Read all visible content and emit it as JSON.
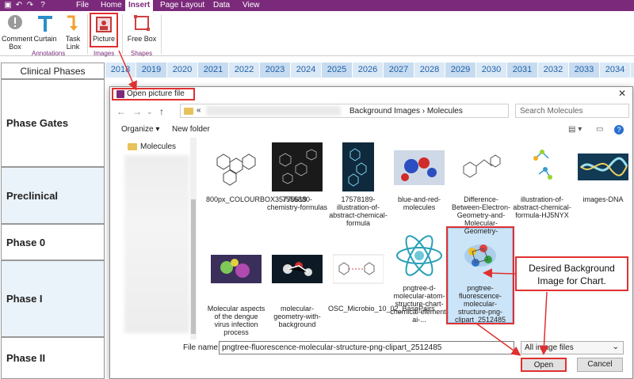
{
  "menubar": {
    "items": [
      {
        "label": "File"
      },
      {
        "label": "Home"
      },
      {
        "label": "Insert",
        "active": true
      },
      {
        "label": "Page Layout"
      },
      {
        "label": "Data"
      },
      {
        "label": "View"
      }
    ]
  },
  "ribbon": {
    "buttons": [
      {
        "label": "Comment Box",
        "line1": "Comment",
        "line2": "Box"
      },
      {
        "label": "Curtain"
      },
      {
        "label": "Task Link"
      },
      {
        "label": "Picture"
      },
      {
        "label": "Free Box"
      }
    ],
    "groups": [
      "Annotations",
      "Images",
      "Shapes"
    ]
  },
  "sheet": {
    "header": "Clinical Phases",
    "years": [
      "2018",
      "2019",
      "2020",
      "2021",
      "2022",
      "2023",
      "2024",
      "2025",
      "2026",
      "2027",
      "2028",
      "2029",
      "2030",
      "2031",
      "2032",
      "2033",
      "2034"
    ],
    "rows": [
      "Phase Gates",
      "Preclinical",
      "Phase 0",
      "Phase I",
      "Phase II"
    ]
  },
  "dialog": {
    "title": "Open picture file",
    "path_prefix": "«",
    "path": "Background Images  ›  Molecules",
    "search_placeholder": "Search Molecules",
    "organize": "Organize ▾",
    "new_folder": "New folder",
    "tree_folder": "Molecules",
    "files": [
      {
        "label": "800px_COLOURBOX35770619"
      },
      {
        "label": "7555880-chemistry-formulas"
      },
      {
        "label": "17578189-illustration-of-abstract-chemical-formula"
      },
      {
        "label": "blue-and-red-molecules"
      },
      {
        "label": "Difference-Between-Electron-Geometry-and-Molecular-Geometry-"
      },
      {
        "label": "illustration-of-abstract-chemical-formula-HJ5NYX"
      },
      {
        "label": "images-DNA"
      },
      {
        "label": "Molecular aspects of the dengue virus infection process"
      },
      {
        "label": "molecular-geometry-with-background"
      },
      {
        "label": "OSC_Microbio_10_02_BasePairs"
      },
      {
        "label": "pngtree-d-molecular-atom-structure-chart-chemical-element-ai-..."
      },
      {
        "label": "pngtree-fluorescence-molecular-structure-png-clipart_2512485"
      }
    ],
    "file_name_label": "File name:",
    "file_name_value": "pngtree-fluorescence-molecular-structure-png-clipart_2512485",
    "filter": "All image files",
    "open_label": "Open",
    "cancel_label": "Cancel"
  },
  "callout": {
    "text": "Desired Background Image for Chart."
  },
  "colors": {
    "accent": "#7b2a7b",
    "highlight": "#e03030",
    "year_text": "#1f5fa8",
    "selection": "#cce4f7"
  }
}
